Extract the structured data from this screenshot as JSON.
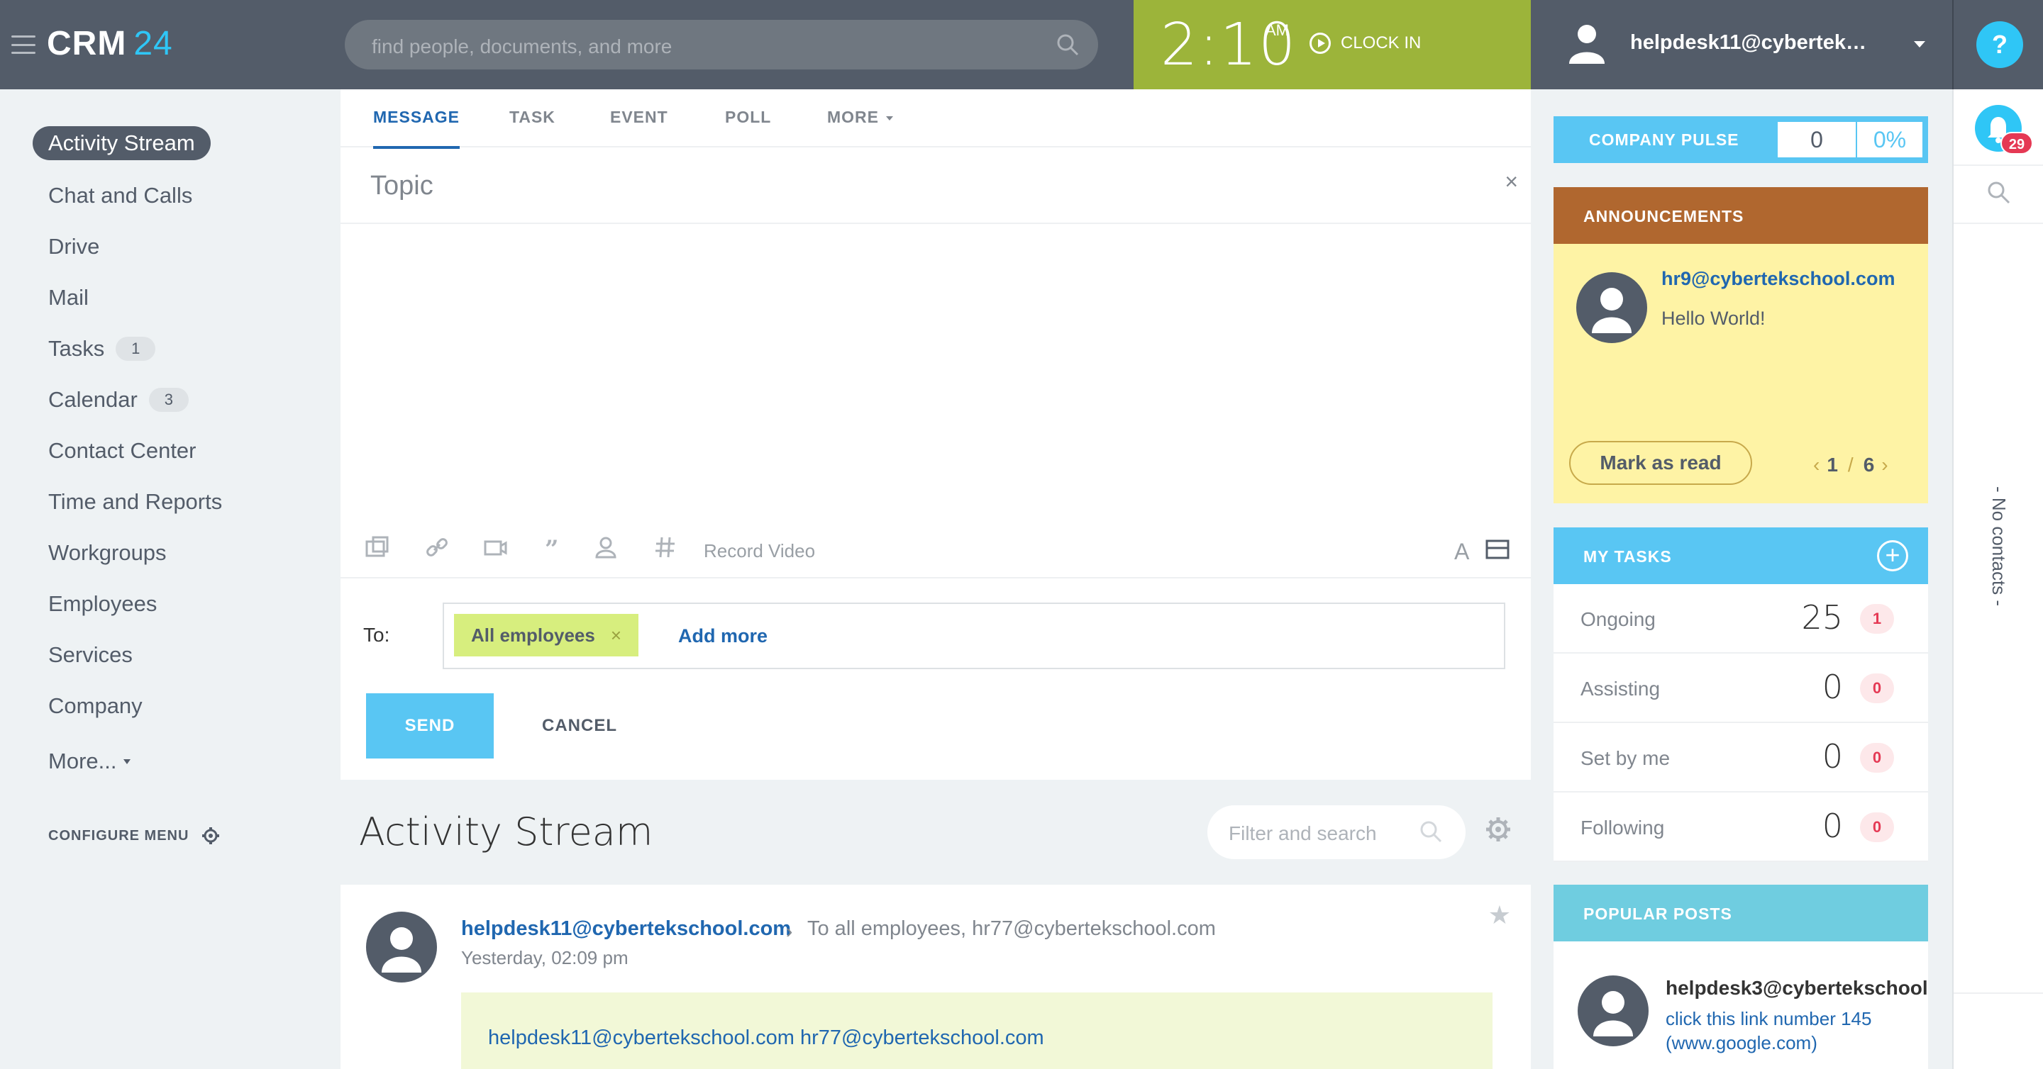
{
  "header": {
    "logo_text": "CRM",
    "logo_number": "24",
    "search_placeholder": "find people, documents, and more",
    "clock_time": "2:10",
    "clock_ampm": "AM",
    "clock_in_label": "CLOCK IN",
    "user_name": "helpdesk11@cyberteksch...",
    "help_label": "?"
  },
  "sidebar": {
    "items": [
      {
        "label": "Activity Stream"
      },
      {
        "label": "Chat and Calls"
      },
      {
        "label": "Drive"
      },
      {
        "label": "Mail"
      },
      {
        "label": "Tasks",
        "badge": "1"
      },
      {
        "label": "Calendar",
        "badge": "3"
      },
      {
        "label": "Contact Center"
      },
      {
        "label": "Time and Reports"
      },
      {
        "label": "Workgroups"
      },
      {
        "label": "Employees"
      },
      {
        "label": "Services"
      },
      {
        "label": "Company"
      },
      {
        "label": "More..."
      }
    ],
    "configure_label": "CONFIGURE MENU"
  },
  "composer": {
    "tabs": [
      "MESSAGE",
      "TASK",
      "EVENT",
      "POLL",
      "MORE"
    ],
    "topic_placeholder": "Topic",
    "close_label": "×",
    "record_video_label": "Record Video",
    "font_label": "A",
    "to_label": "To:",
    "recipient_chip": "All employees",
    "chip_remove": "×",
    "add_more_label": "Add more",
    "send_label": "SEND",
    "cancel_label": "CANCEL"
  },
  "stream": {
    "title": "Activity Stream",
    "filter_placeholder": "Filter and search",
    "post": {
      "author": "helpdesk11@cybertekschool.com",
      "arrow": "›",
      "recipients": "To all employees, hr77@cybertekschool.com",
      "date": "Yesterday, 02:09 pm",
      "body": "helpdesk11@cybertekschool.com hr77@cybertekschool.com",
      "star": "★"
    }
  },
  "pulse": {
    "label": "COMPANY PULSE",
    "value": "0",
    "percent": "0%"
  },
  "announcements": {
    "title": "ANNOUNCEMENTS",
    "author": "hr9@cybertekschool.com",
    "text": "Hello World!",
    "mark_read_label": "Mark as read",
    "page_current": "1",
    "page_sep": "/",
    "page_total": "6",
    "prev": "‹",
    "next": "›"
  },
  "my_tasks": {
    "title": "MY TASKS",
    "add_label": "+",
    "rows": [
      {
        "label": "Ongoing",
        "value": "25",
        "count": "1"
      },
      {
        "label": "Assisting",
        "value": "0",
        "count": "0"
      },
      {
        "label": "Set by me",
        "value": "0",
        "count": "0"
      },
      {
        "label": "Following",
        "value": "0",
        "count": "0"
      }
    ]
  },
  "popular_posts": {
    "title": "POPULAR POSTS",
    "author": "helpdesk3@cybertekschool.",
    "link": "click this link number 145 (www.google.com)"
  },
  "right_panel": {
    "notification_count": "29",
    "no_contacts": "- No contacts -"
  },
  "colors": {
    "header_bg": "#535c69",
    "accent_blue": "#2fc6f6",
    "clock_green": "#9cb43a",
    "link_blue": "#2067b0",
    "announcement_brown": "#b0672f",
    "announcement_bg": "#fef3a5",
    "chip_green": "#d7ee7e",
    "badge_red": "#e53954"
  }
}
